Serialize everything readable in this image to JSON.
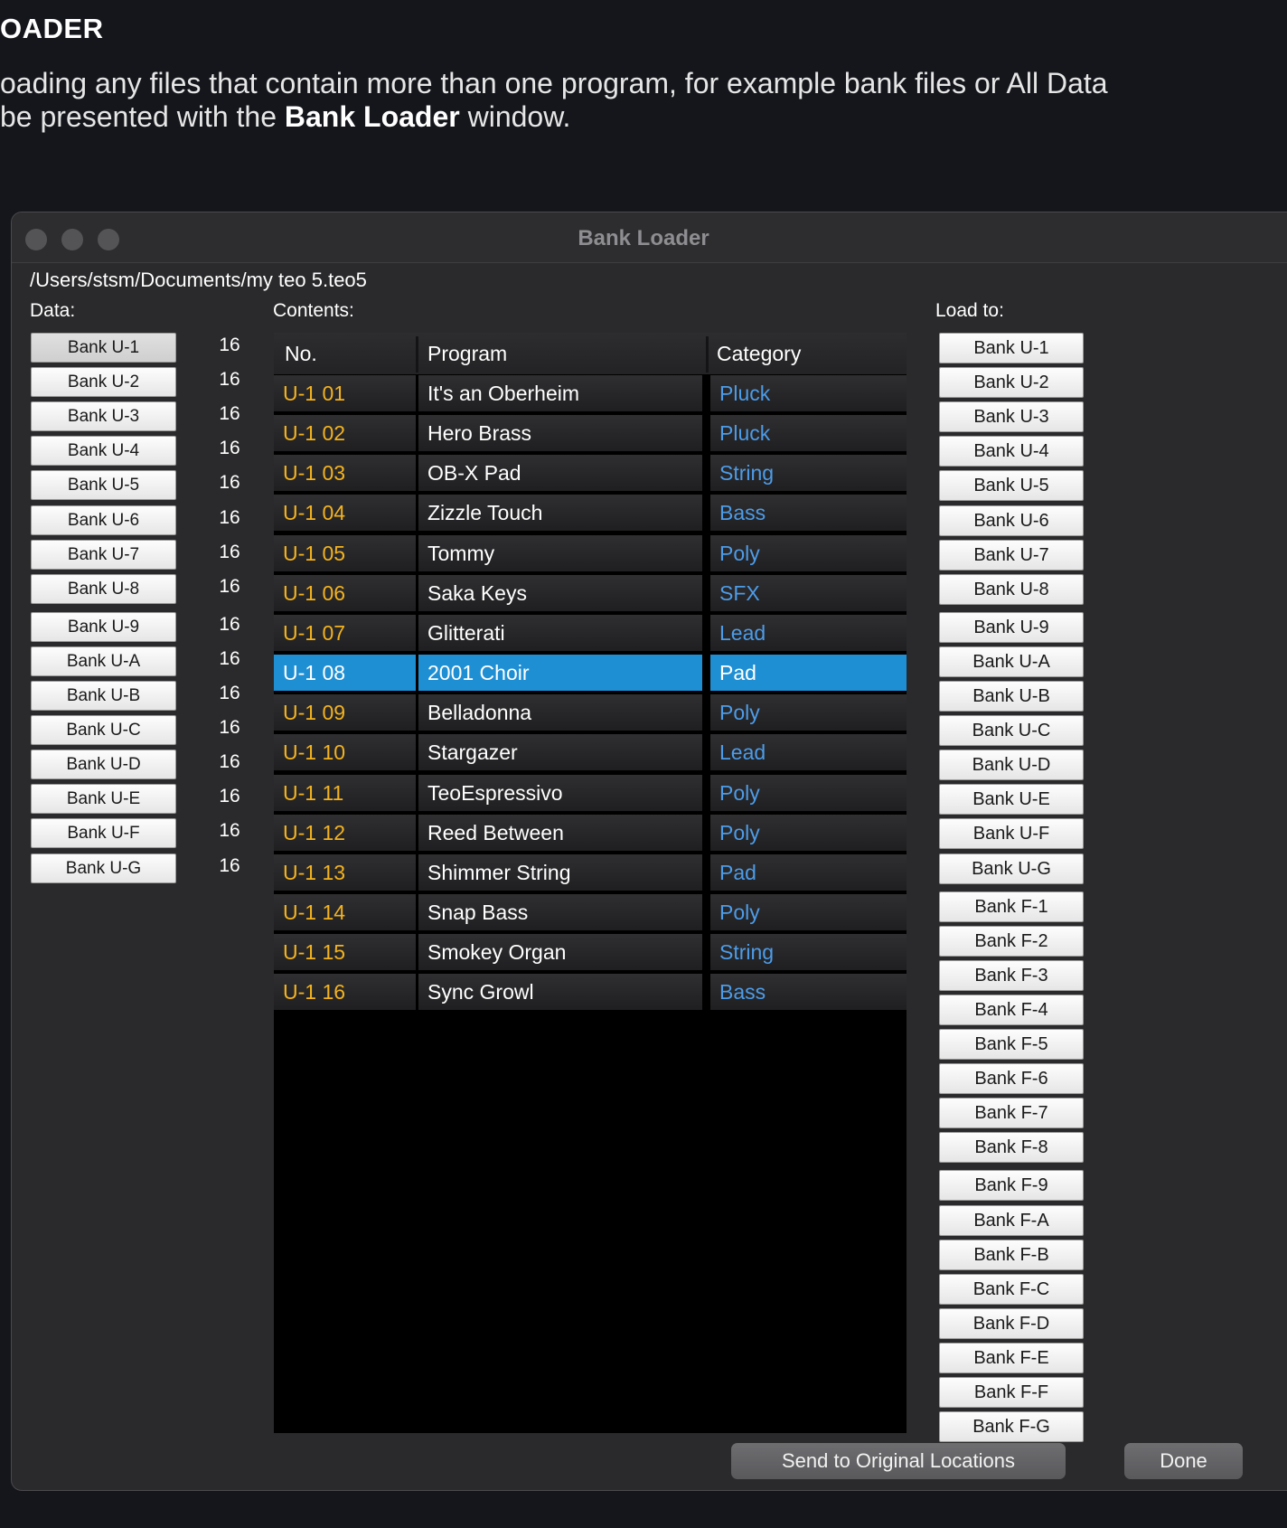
{
  "doc": {
    "heading": "OADER",
    "para_line1": "oading any files that contain more than one program, for example bank files or All Data",
    "para_line2_pre": " be presented with the ",
    "para_line2_bold": "Bank Loader",
    "para_line2_post": " window."
  },
  "window": {
    "title": "Bank Loader",
    "path": "/Users/stsm/Documents/my teo 5.teo5",
    "data_label": "Data:",
    "contents_label": "Contents:",
    "load_to_label": "Load to:"
  },
  "data_banks": [
    {
      "label": "Bank U-1",
      "count": "16"
    },
    {
      "label": "Bank U-2",
      "count": "16"
    },
    {
      "label": "Bank U-3",
      "count": "16"
    },
    {
      "label": "Bank U-4",
      "count": "16"
    },
    {
      "label": "Bank U-5",
      "count": "16"
    },
    {
      "label": "Bank U-6",
      "count": "16"
    },
    {
      "label": "Bank U-7",
      "count": "16"
    },
    {
      "label": "Bank U-8",
      "count": "16"
    },
    {
      "label": "Bank U-9",
      "count": "16"
    },
    {
      "label": "Bank U-A",
      "count": "16"
    },
    {
      "label": "Bank U-B",
      "count": "16"
    },
    {
      "label": "Bank U-C",
      "count": "16"
    },
    {
      "label": "Bank U-D",
      "count": "16"
    },
    {
      "label": "Bank U-E",
      "count": "16"
    },
    {
      "label": "Bank U-F",
      "count": "16"
    },
    {
      "label": "Bank U-G",
      "count": "16"
    }
  ],
  "table": {
    "headers": {
      "no": "No.",
      "program": "Program",
      "category": "Category"
    },
    "rows": [
      {
        "no": "U-1 01",
        "program": "It's an Oberheim",
        "category": "Pluck"
      },
      {
        "no": "U-1 02",
        "program": "Hero Brass",
        "category": "Pluck"
      },
      {
        "no": "U-1 03",
        "program": "OB-X Pad",
        "category": "String"
      },
      {
        "no": "U-1 04",
        "program": "Zizzle Touch",
        "category": "Bass"
      },
      {
        "no": "U-1 05",
        "program": "Tommy",
        "category": "Poly"
      },
      {
        "no": "U-1 06",
        "program": "Saka  Keys",
        "category": "SFX"
      },
      {
        "no": "U-1 07",
        "program": "Glitterati",
        "category": "Lead"
      },
      {
        "no": "U-1 08",
        "program": "2001 Choir",
        "category": "Pad"
      },
      {
        "no": "U-1 09",
        "program": "Belladonna",
        "category": "Poly"
      },
      {
        "no": "U-1 10",
        "program": "Stargazer",
        "category": "Lead"
      },
      {
        "no": "U-1 11",
        "program": "TeoEspressivo",
        "category": "Poly"
      },
      {
        "no": "U-1 12",
        "program": "Reed Between",
        "category": "Poly"
      },
      {
        "no": "U-1 13",
        "program": "Shimmer String",
        "category": "Pad"
      },
      {
        "no": "U-1 14",
        "program": "Snap Bass",
        "category": "Poly"
      },
      {
        "no": "U-1 15",
        "program": "Smokey Organ",
        "category": "String"
      },
      {
        "no": "U-1 16",
        "program": "Sync Growl",
        "category": "Bass"
      }
    ],
    "selected_index": 7
  },
  "load_to": [
    "Bank U-1",
    "Bank U-2",
    "Bank U-3",
    "Bank U-4",
    "Bank U-5",
    "Bank U-6",
    "Bank U-7",
    "Bank U-8",
    "Bank U-9",
    "Bank U-A",
    "Bank U-B",
    "Bank U-C",
    "Bank U-D",
    "Bank U-E",
    "Bank U-F",
    "Bank U-G",
    "Bank F-1",
    "Bank F-2",
    "Bank F-3",
    "Bank F-4",
    "Bank F-5",
    "Bank F-6",
    "Bank F-7",
    "Bank F-8",
    "Bank F-9",
    "Bank F-A",
    "Bank F-B",
    "Bank F-C",
    "Bank F-D",
    "Bank F-E",
    "Bank F-F",
    "Bank F-G"
  ],
  "buttons": {
    "send": "Send to Original Locations",
    "done": "Done"
  },
  "colors": {
    "program_number": "#f4b31f",
    "category": "#4d9ce8",
    "selection": "#1f8fd4"
  }
}
